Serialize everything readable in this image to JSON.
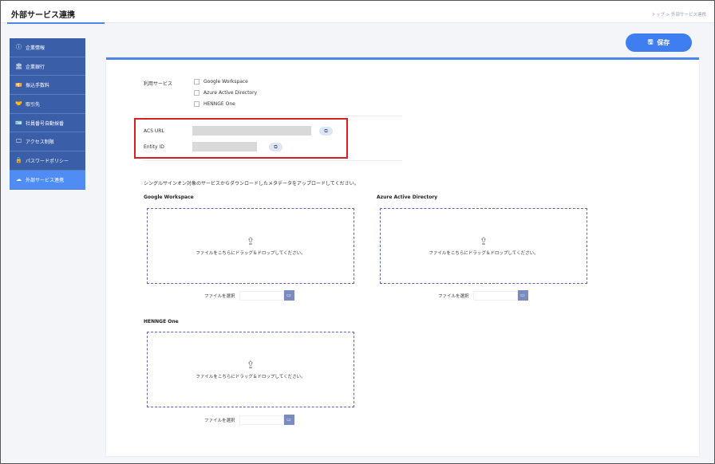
{
  "header": {
    "title": "外部サービス連携",
    "breadcrumb": "トップ > 外部サービス連携"
  },
  "sidebar": {
    "items": [
      {
        "icon": "info-icon",
        "glyph": "ⓘ",
        "label": "企業情報"
      },
      {
        "icon": "bank-icon",
        "glyph": "🏛",
        "label": "企業銀行"
      },
      {
        "icon": "fee-icon",
        "glyph": "💴",
        "label": "振込手数料"
      },
      {
        "icon": "handshake-icon",
        "glyph": "🤝",
        "label": "取引先"
      },
      {
        "icon": "id-card-icon",
        "glyph": "🪪",
        "label": "社員番号自動採番"
      },
      {
        "icon": "monitor-icon",
        "glyph": "🖵",
        "label": "アクセス制限"
      },
      {
        "icon": "lock-icon",
        "glyph": "🔒",
        "label": "パスワードポリシー"
      },
      {
        "icon": "cloud-icon",
        "glyph": "☁",
        "label": "外部サービス連携"
      }
    ],
    "active_index": 7
  },
  "toolbar": {
    "save_label": "保存"
  },
  "services": {
    "label": "利用サービス",
    "options": [
      "Google Workspace",
      "Azure Active Directory",
      "HENNGE One"
    ]
  },
  "sso": {
    "acs_label": "ACS URL",
    "entity_label": "Entity ID"
  },
  "upload": {
    "description": "シングルサインオン対象のサービスからダウンロードしたメタデータをアップロードしてください。",
    "dropzone_text": "ファイルをこちらにドラッグ＆ドロップしてください。",
    "choose_file_label": "ファイルを選択",
    "sections": [
      "Google Workspace",
      "Azure Active Directory",
      "HENNGE One"
    ]
  },
  "colors": {
    "sidebar": "#3a5ea8",
    "sidebar_active": "#4f8df5",
    "accent": "#3f7ef0",
    "highlight": "#d91f26"
  }
}
